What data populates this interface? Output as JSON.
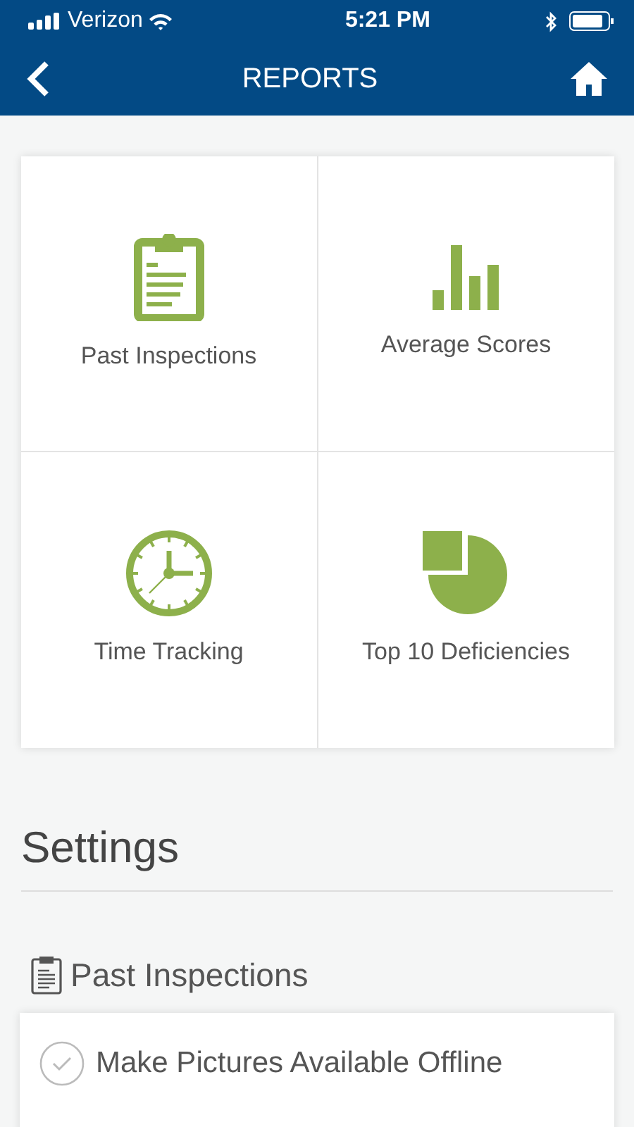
{
  "status_bar": {
    "carrier": "Verizon",
    "time": "5:21 PM"
  },
  "header": {
    "title": "REPORTS"
  },
  "tiles": [
    {
      "kind": "clipboard",
      "label": "Past Inspections"
    },
    {
      "kind": "bars",
      "label": "Average Scores"
    },
    {
      "kind": "clock",
      "label": "Time Tracking"
    },
    {
      "kind": "pie",
      "label": "Top 10 Deficiencies"
    }
  ],
  "settings": {
    "title": "Settings",
    "section": "Past Inspections",
    "options": [
      {
        "label": "Make Pictures Available Offline",
        "checked": false
      }
    ]
  }
}
